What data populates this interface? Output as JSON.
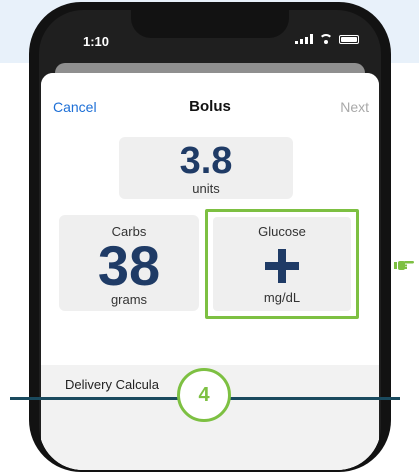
{
  "status_bar": {
    "time": "1:10"
  },
  "nav": {
    "cancel_label": "Cancel",
    "title": "Bolus",
    "next_label": "Next"
  },
  "insulin": {
    "value": "3.8",
    "unit": "units"
  },
  "carbs": {
    "label": "Carbs",
    "value": "38",
    "unit": "grams"
  },
  "glucose": {
    "label": "Glucose",
    "icon": "plus-icon",
    "unit": "mg/dL"
  },
  "delivery": {
    "label": "Delivery Calcula"
  },
  "step": {
    "number": "4"
  },
  "colors": {
    "accent_blue": "#1d6fd6",
    "value_navy": "#1f3b66",
    "highlight_green": "#7dc042",
    "step_line": "#1a4a5e"
  }
}
